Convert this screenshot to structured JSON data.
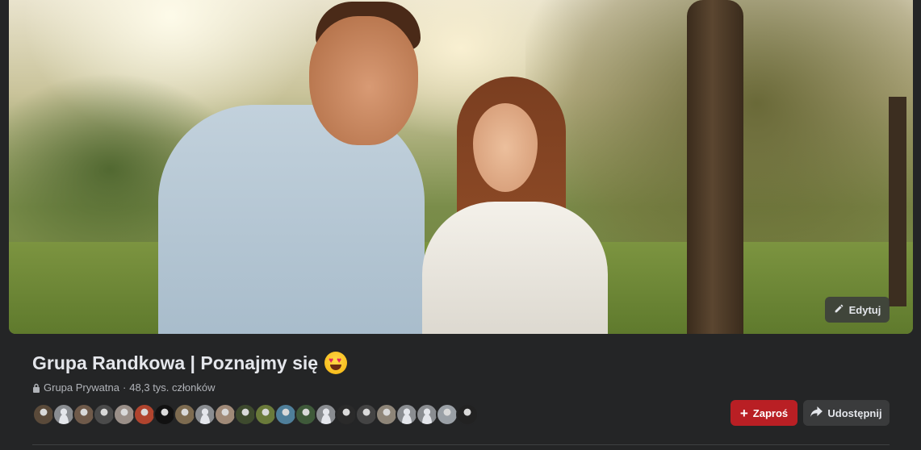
{
  "cover": {
    "edit_label": "Edytuj",
    "edit_icon": "pencil-icon"
  },
  "group": {
    "name": "Grupa Randkowa | Poznajmy się",
    "title_emoji": "smiling-face-with-heart-eyes",
    "privacy": "Grupa Prywatna",
    "separator": " · ",
    "members": "48,3 tys. członków"
  },
  "member_avatars": [
    {
      "color": "#5a4a3a"
    },
    {
      "color": "#8a8d91"
    },
    {
      "color": "#6f5a4a"
    },
    {
      "color": "#4b4b4b"
    },
    {
      "color": "#9a8f88"
    },
    {
      "color": "#b0442e"
    },
    {
      "color": "#111111"
    },
    {
      "color": "#7d6b50"
    },
    {
      "color": "#8a8d91"
    },
    {
      "color": "#a08a78"
    },
    {
      "color": "#3e4a2e"
    },
    {
      "color": "#6a7a3a"
    },
    {
      "color": "#4f7f9a"
    },
    {
      "color": "#3f5a3a"
    },
    {
      "color": "#8a8d91"
    },
    {
      "color": "#2a2a2a"
    },
    {
      "color": "#444444"
    },
    {
      "color": "#8e8578"
    },
    {
      "color": "#8a8d91"
    },
    {
      "color": "#8a8d91"
    },
    {
      "color": "#9aa0a6"
    },
    {
      "color": "#222222"
    }
  ],
  "actions": {
    "invite_label": "Zaproś",
    "share_label": "Udostępnij"
  },
  "colors": {
    "invite_bg": "#b91f24",
    "page_bg": "#242526",
    "text_primary": "#e4e6eb",
    "text_secondary": "#b0b3b8"
  }
}
